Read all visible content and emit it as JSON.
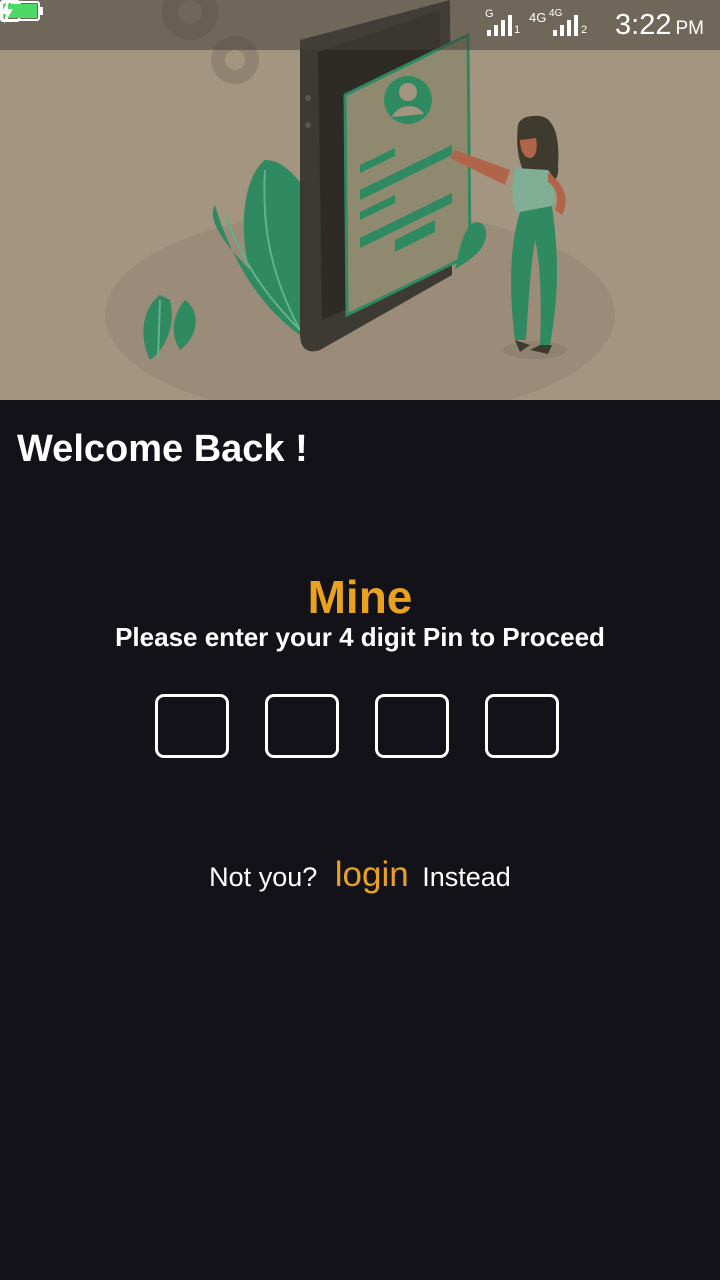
{
  "status_bar": {
    "time": "3:22",
    "ampm": "PM",
    "network_1": "G",
    "network_2": "4G",
    "network_3": "4G",
    "sim_1": "1",
    "sim_2": "2",
    "battery_level": 1.0,
    "icons": [
      "usb-icon",
      "twitter-icon",
      "twitter-icon",
      "message-icon",
      "more-icon",
      "vibrate-icon",
      "signal-icon",
      "signal-icon",
      "battery-icon",
      "charging-icon"
    ]
  },
  "hero": {
    "illustration": "woman-with-phone-profile-illustration"
  },
  "welcome_title": "Welcome Back !",
  "brand_name": "Mine",
  "pin_prompt": "Please enter your 4 digit Pin to Proceed",
  "pin": {
    "digits": [
      "",
      "",
      "",
      ""
    ]
  },
  "switch_account": {
    "prefix": "Not you?",
    "link": "login",
    "suffix": "Instead"
  },
  "colors": {
    "background": "#131219",
    "accent": "#e8a21f",
    "hero_bg": "#a39580",
    "illustration_green": "#2f8a62"
  }
}
